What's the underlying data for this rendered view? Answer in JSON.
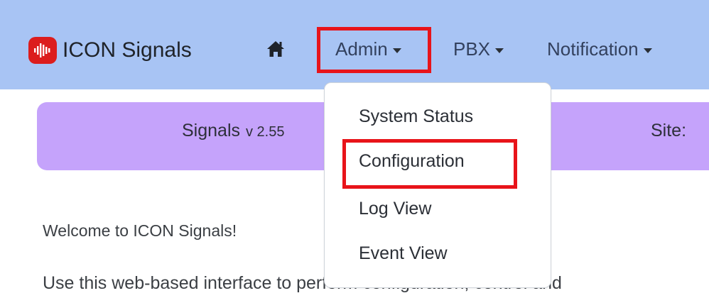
{
  "navbar": {
    "brand": "ICON Signals",
    "background": "#a8c4f4",
    "home_icon": "home-icon",
    "items": [
      {
        "label": "Admin"
      },
      {
        "label": "PBX"
      },
      {
        "label": "Notification"
      }
    ]
  },
  "banner": {
    "app_name": "Signals",
    "version": "v 2.55",
    "site_label": "Site:",
    "background": "#c5a3fb"
  },
  "dropdown": {
    "items": [
      {
        "label": "System Status"
      },
      {
        "label": "Configuration"
      },
      {
        "label": "Log View"
      },
      {
        "label": "Event View"
      }
    ]
  },
  "content": {
    "welcome": "Welcome to ICON Signals!",
    "intro": "Use this web-based interface to perform configuration, control and"
  },
  "annotation_color": "#e8141a"
}
